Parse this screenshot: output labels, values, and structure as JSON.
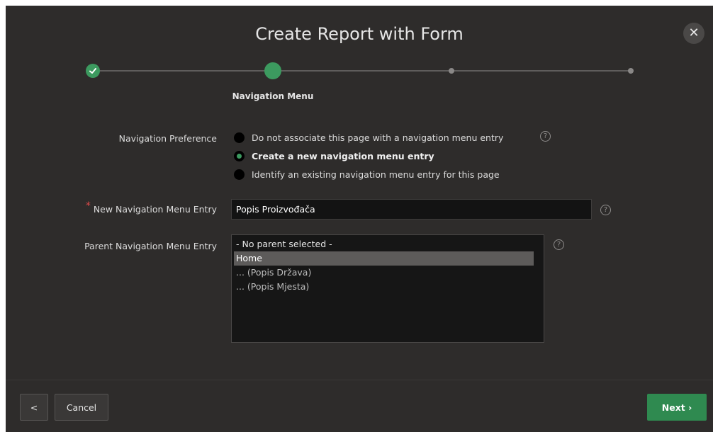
{
  "dialog": {
    "title": "Create Report with Form",
    "close_symbol": "✕"
  },
  "wizard": {
    "current_step_label": "Navigation Menu"
  },
  "navigation_preference": {
    "label": "Navigation Preference",
    "options": [
      {
        "label": "Do not associate this page with a navigation menu entry",
        "selected": false
      },
      {
        "label": "Create a new navigation menu entry",
        "selected": true
      },
      {
        "label": "Identify an existing navigation menu entry for this page",
        "selected": false
      }
    ]
  },
  "new_entry": {
    "label": "New Navigation Menu Entry",
    "required_marker": "*",
    "value": "Popis Proizvođača"
  },
  "parent_entry": {
    "label": "Parent Navigation Menu Entry",
    "options": [
      "- No parent selected -",
      "Home",
      "... (Popis Država)",
      "... (Popis Mjesta)"
    ],
    "selected": "Home"
  },
  "help_symbol": "?",
  "footer": {
    "prev_symbol": "<",
    "cancel_label": "Cancel",
    "next_label": "Next ›"
  },
  "colors": {
    "accent": "#3c9a5f",
    "background": "#2e2c2b",
    "required": "#e04a4a"
  },
  "icons": [
    "close-icon",
    "checkmark-icon",
    "help-icon",
    "chevron-left-icon",
    "chevron-right-icon"
  ]
}
